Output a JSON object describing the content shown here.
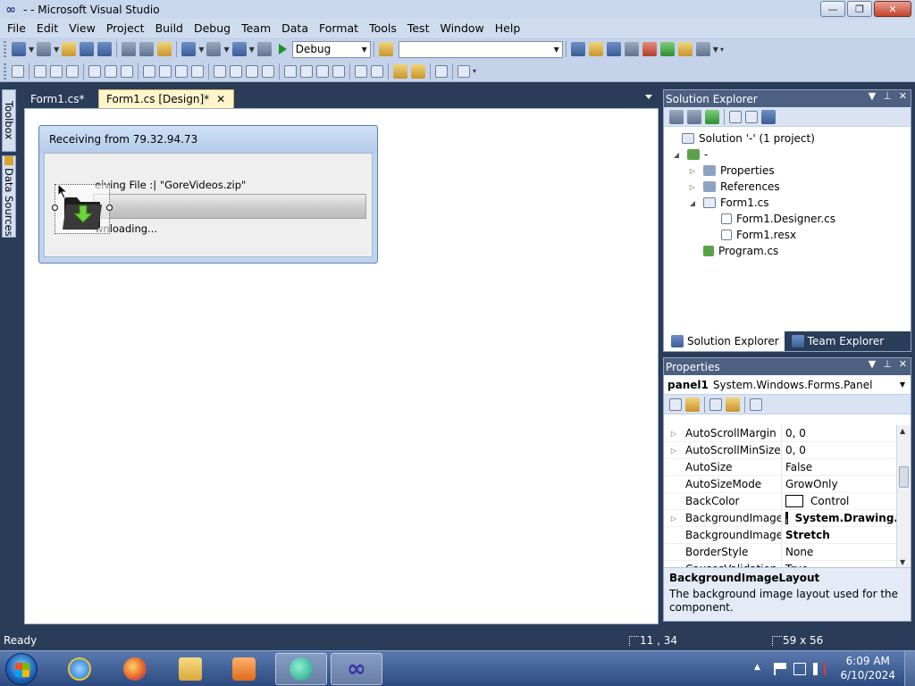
{
  "window": {
    "title": "- - Microsoft Visual Studio",
    "minimize": "—",
    "restore": "❐",
    "close": "✕"
  },
  "menu": [
    "File",
    "Edit",
    "View",
    "Project",
    "Build",
    "Debug",
    "Team",
    "Data",
    "Format",
    "Tools",
    "Test",
    "Window",
    "Help"
  ],
  "toolbar": {
    "config": "Debug",
    "platform": ""
  },
  "left_tabs": {
    "toolbox": "Toolbox",
    "data_sources": "Data Sources"
  },
  "doc_tabs": {
    "inactive": "Form1.cs*",
    "active": "Form1.cs [Design]*",
    "close": "✕"
  },
  "form": {
    "caption": "Receiving from 79.32.94.73",
    "file_label": "Receiving File :| \"GoreVideos.zip\"",
    "file_label_visible": "eiving File :| \"GoreVideos.zip\"",
    "status_label_visible": "wnloading...",
    "progress": 0
  },
  "solution_explorer": {
    "title": "Solution Explorer",
    "pin": "▾   ⫩  ✕",
    "tree": [
      {
        "label": "Solution '-' (1 project)",
        "level": 0,
        "arrow": ""
      },
      {
        "label": "-",
        "level": 1,
        "arrow": "◢"
      },
      {
        "label": "Properties",
        "level": 2,
        "arrow": "▷"
      },
      {
        "label": "References",
        "level": 2,
        "arrow": "▷"
      },
      {
        "label": "Form1.cs",
        "level": 2,
        "arrow": "◢"
      },
      {
        "label": "Form1.Designer.cs",
        "level": 3,
        "arrow": ""
      },
      {
        "label": "Form1.resx",
        "level": 3,
        "arrow": ""
      },
      {
        "label": "Program.cs",
        "level": 2,
        "arrow": ""
      }
    ],
    "tabs": {
      "solution": "Solution Explorer",
      "team": "Team Explorer"
    }
  },
  "properties": {
    "title": "Properties",
    "object_name": "panel1",
    "object_type": "System.Windows.Forms.Panel",
    "rows": [
      {
        "name": "AutoScrollMargin",
        "value": "0, 0",
        "expandable": true
      },
      {
        "name": "AutoScrollMinSize",
        "value": "0, 0",
        "expandable": true
      },
      {
        "name": "AutoSize",
        "value": "False",
        "expandable": false
      },
      {
        "name": "AutoSizeMode",
        "value": "GrowOnly",
        "expandable": false
      },
      {
        "name": "BackColor",
        "value": "Control",
        "expandable": false,
        "swatch": "color"
      },
      {
        "name": "BackgroundImage",
        "value": "System.Drawing.",
        "expandable": true,
        "swatch": "img",
        "bold": true
      },
      {
        "name": "BackgroundImageLa",
        "value": "Stretch",
        "expandable": false,
        "bold": true
      },
      {
        "name": "BorderStyle",
        "value": "None",
        "expandable": false
      },
      {
        "name": "CausesValidation",
        "value": "True",
        "expandable": false
      }
    ],
    "description_title": "BackgroundImageLayout",
    "description_text": "The background image layout used for the component."
  },
  "status": {
    "ready": "Ready",
    "position": "11 , 34",
    "size": "59 x 56"
  },
  "taskbar": {
    "time": "6:09 AM",
    "date": "6/10/2024"
  }
}
